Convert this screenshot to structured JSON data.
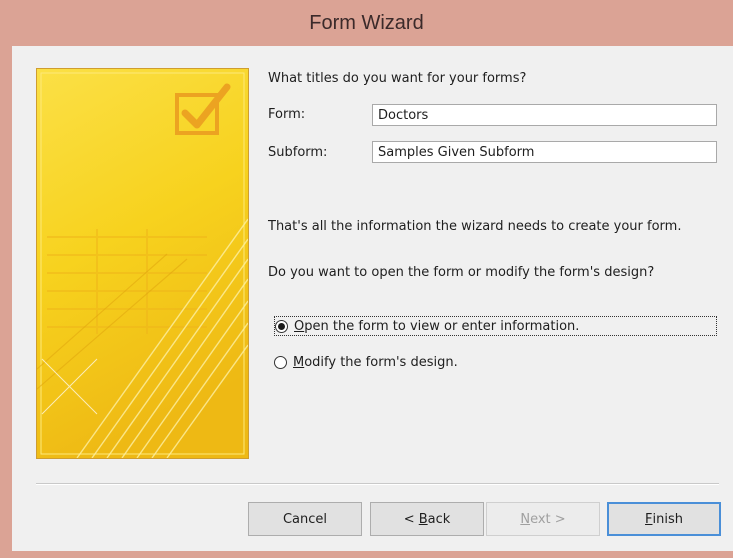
{
  "window": {
    "title": "Form Wizard"
  },
  "heading": "What titles do you want for your forms?",
  "form_field": {
    "label": "Form:",
    "value": "Doctors"
  },
  "subform_field": {
    "label": "Subform:",
    "value": "Samples Given Subform"
  },
  "info_text": "That's all the information the wizard needs to create your form.",
  "question_text": "Do you want to open the form or modify the form's design?",
  "options": [
    {
      "accel": "O",
      "rest": "pen the form to view or enter information.",
      "checked": true
    },
    {
      "accel": "M",
      "rest": "odify the form's design.",
      "checked": false
    }
  ],
  "buttons": {
    "cancel": "Cancel",
    "back": {
      "prefix": "< ",
      "accel": "B",
      "rest": "ack"
    },
    "next": {
      "accel": "N",
      "rest": "ext >"
    },
    "finish": {
      "accel": "F",
      "rest": "inish"
    }
  },
  "colors": {
    "title_bar": "#dba395",
    "dialog_bg": "#f0f0f0",
    "art_yellow": "#f7d21e",
    "default_button_border": "#4a8fd8"
  },
  "icons": {
    "art_panel": "checkbox-check-icon"
  }
}
